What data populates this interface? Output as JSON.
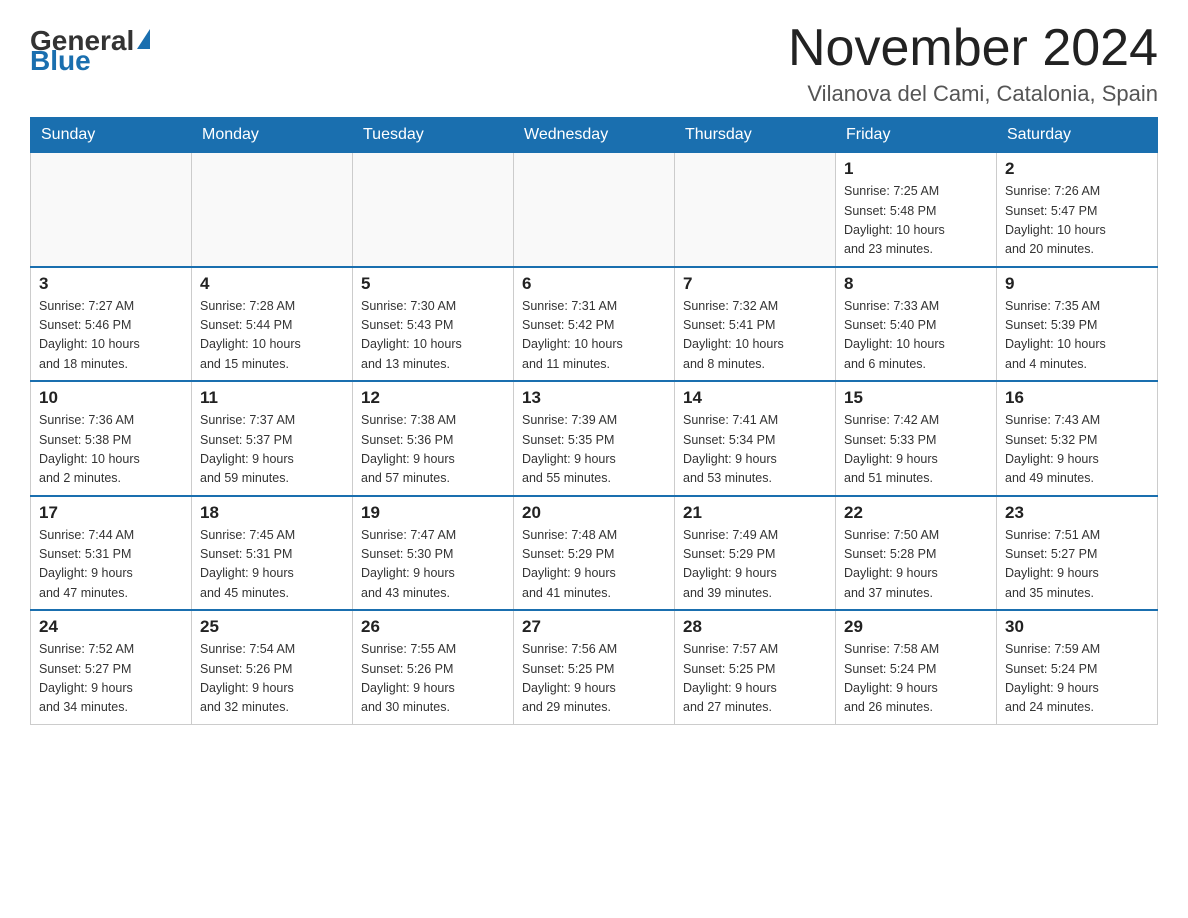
{
  "logo": {
    "general": "General",
    "blue": "Blue",
    "triangle": "▶"
  },
  "title": "November 2024",
  "location": "Vilanova del Cami, Catalonia, Spain",
  "days_of_week": [
    "Sunday",
    "Monday",
    "Tuesday",
    "Wednesday",
    "Thursday",
    "Friday",
    "Saturday"
  ],
  "weeks": [
    [
      {
        "day": "",
        "info": ""
      },
      {
        "day": "",
        "info": ""
      },
      {
        "day": "",
        "info": ""
      },
      {
        "day": "",
        "info": ""
      },
      {
        "day": "",
        "info": ""
      },
      {
        "day": "1",
        "info": "Sunrise: 7:25 AM\nSunset: 5:48 PM\nDaylight: 10 hours\nand 23 minutes."
      },
      {
        "day": "2",
        "info": "Sunrise: 7:26 AM\nSunset: 5:47 PM\nDaylight: 10 hours\nand 20 minutes."
      }
    ],
    [
      {
        "day": "3",
        "info": "Sunrise: 7:27 AM\nSunset: 5:46 PM\nDaylight: 10 hours\nand 18 minutes."
      },
      {
        "day": "4",
        "info": "Sunrise: 7:28 AM\nSunset: 5:44 PM\nDaylight: 10 hours\nand 15 minutes."
      },
      {
        "day": "5",
        "info": "Sunrise: 7:30 AM\nSunset: 5:43 PM\nDaylight: 10 hours\nand 13 minutes."
      },
      {
        "day": "6",
        "info": "Sunrise: 7:31 AM\nSunset: 5:42 PM\nDaylight: 10 hours\nand 11 minutes."
      },
      {
        "day": "7",
        "info": "Sunrise: 7:32 AM\nSunset: 5:41 PM\nDaylight: 10 hours\nand 8 minutes."
      },
      {
        "day": "8",
        "info": "Sunrise: 7:33 AM\nSunset: 5:40 PM\nDaylight: 10 hours\nand 6 minutes."
      },
      {
        "day": "9",
        "info": "Sunrise: 7:35 AM\nSunset: 5:39 PM\nDaylight: 10 hours\nand 4 minutes."
      }
    ],
    [
      {
        "day": "10",
        "info": "Sunrise: 7:36 AM\nSunset: 5:38 PM\nDaylight: 10 hours\nand 2 minutes."
      },
      {
        "day": "11",
        "info": "Sunrise: 7:37 AM\nSunset: 5:37 PM\nDaylight: 9 hours\nand 59 minutes."
      },
      {
        "day": "12",
        "info": "Sunrise: 7:38 AM\nSunset: 5:36 PM\nDaylight: 9 hours\nand 57 minutes."
      },
      {
        "day": "13",
        "info": "Sunrise: 7:39 AM\nSunset: 5:35 PM\nDaylight: 9 hours\nand 55 minutes."
      },
      {
        "day": "14",
        "info": "Sunrise: 7:41 AM\nSunset: 5:34 PM\nDaylight: 9 hours\nand 53 minutes."
      },
      {
        "day": "15",
        "info": "Sunrise: 7:42 AM\nSunset: 5:33 PM\nDaylight: 9 hours\nand 51 minutes."
      },
      {
        "day": "16",
        "info": "Sunrise: 7:43 AM\nSunset: 5:32 PM\nDaylight: 9 hours\nand 49 minutes."
      }
    ],
    [
      {
        "day": "17",
        "info": "Sunrise: 7:44 AM\nSunset: 5:31 PM\nDaylight: 9 hours\nand 47 minutes."
      },
      {
        "day": "18",
        "info": "Sunrise: 7:45 AM\nSunset: 5:31 PM\nDaylight: 9 hours\nand 45 minutes."
      },
      {
        "day": "19",
        "info": "Sunrise: 7:47 AM\nSunset: 5:30 PM\nDaylight: 9 hours\nand 43 minutes."
      },
      {
        "day": "20",
        "info": "Sunrise: 7:48 AM\nSunset: 5:29 PM\nDaylight: 9 hours\nand 41 minutes."
      },
      {
        "day": "21",
        "info": "Sunrise: 7:49 AM\nSunset: 5:29 PM\nDaylight: 9 hours\nand 39 minutes."
      },
      {
        "day": "22",
        "info": "Sunrise: 7:50 AM\nSunset: 5:28 PM\nDaylight: 9 hours\nand 37 minutes."
      },
      {
        "day": "23",
        "info": "Sunrise: 7:51 AM\nSunset: 5:27 PM\nDaylight: 9 hours\nand 35 minutes."
      }
    ],
    [
      {
        "day": "24",
        "info": "Sunrise: 7:52 AM\nSunset: 5:27 PM\nDaylight: 9 hours\nand 34 minutes."
      },
      {
        "day": "25",
        "info": "Sunrise: 7:54 AM\nSunset: 5:26 PM\nDaylight: 9 hours\nand 32 minutes."
      },
      {
        "day": "26",
        "info": "Sunrise: 7:55 AM\nSunset: 5:26 PM\nDaylight: 9 hours\nand 30 minutes."
      },
      {
        "day": "27",
        "info": "Sunrise: 7:56 AM\nSunset: 5:25 PM\nDaylight: 9 hours\nand 29 minutes."
      },
      {
        "day": "28",
        "info": "Sunrise: 7:57 AM\nSunset: 5:25 PM\nDaylight: 9 hours\nand 27 minutes."
      },
      {
        "day": "29",
        "info": "Sunrise: 7:58 AM\nSunset: 5:24 PM\nDaylight: 9 hours\nand 26 minutes."
      },
      {
        "day": "30",
        "info": "Sunrise: 7:59 AM\nSunset: 5:24 PM\nDaylight: 9 hours\nand 24 minutes."
      }
    ]
  ]
}
